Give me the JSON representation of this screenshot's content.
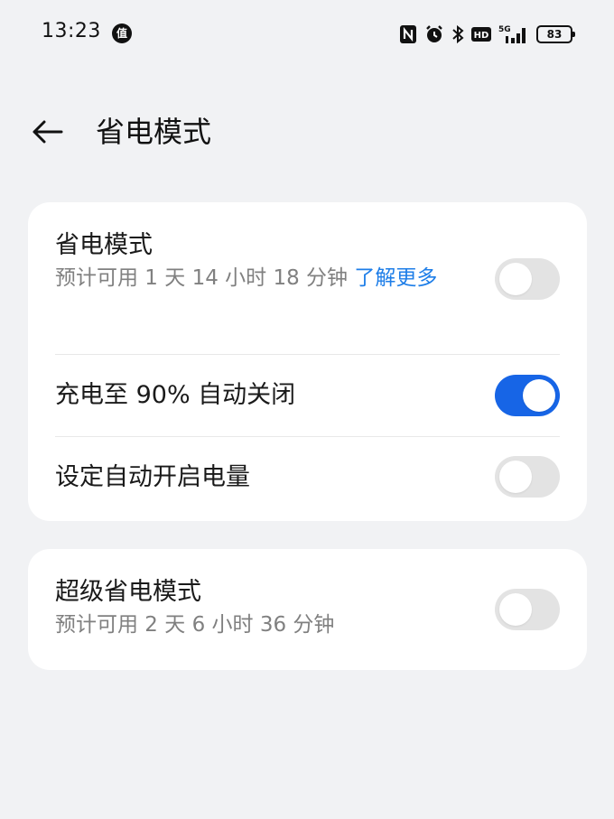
{
  "status_bar": {
    "time": "13:23",
    "notification_icon_glyph": "值",
    "icons": [
      "nfc-icon",
      "alarm-icon",
      "bluetooth-icon",
      "hd-icon",
      "5g-signal-icon"
    ],
    "signal_label": "5G",
    "hd_label": "HD",
    "battery_level": "83"
  },
  "header": {
    "title": "省电模式"
  },
  "card1": {
    "power_saving": {
      "title": "省电模式",
      "subtitle": "预计可用 1 天 14 小时 18 分钟 ",
      "learn_more": "了解更多",
      "enabled": false
    },
    "auto_off_at_90": {
      "title": "充电至 90% 自动关闭",
      "enabled": true
    },
    "auto_enable_level": {
      "title": "设定自动开启电量",
      "enabled": false
    }
  },
  "card2": {
    "super_power_saving": {
      "title": "超级省电模式",
      "subtitle": "预计可用 2 天 6 小时 36 分钟",
      "enabled": false
    }
  },
  "colors": {
    "background": "#f1f2f4",
    "toggle_on": "#1765e6",
    "toggle_off": "#e3e3e3",
    "link": "#1e7ee8"
  }
}
